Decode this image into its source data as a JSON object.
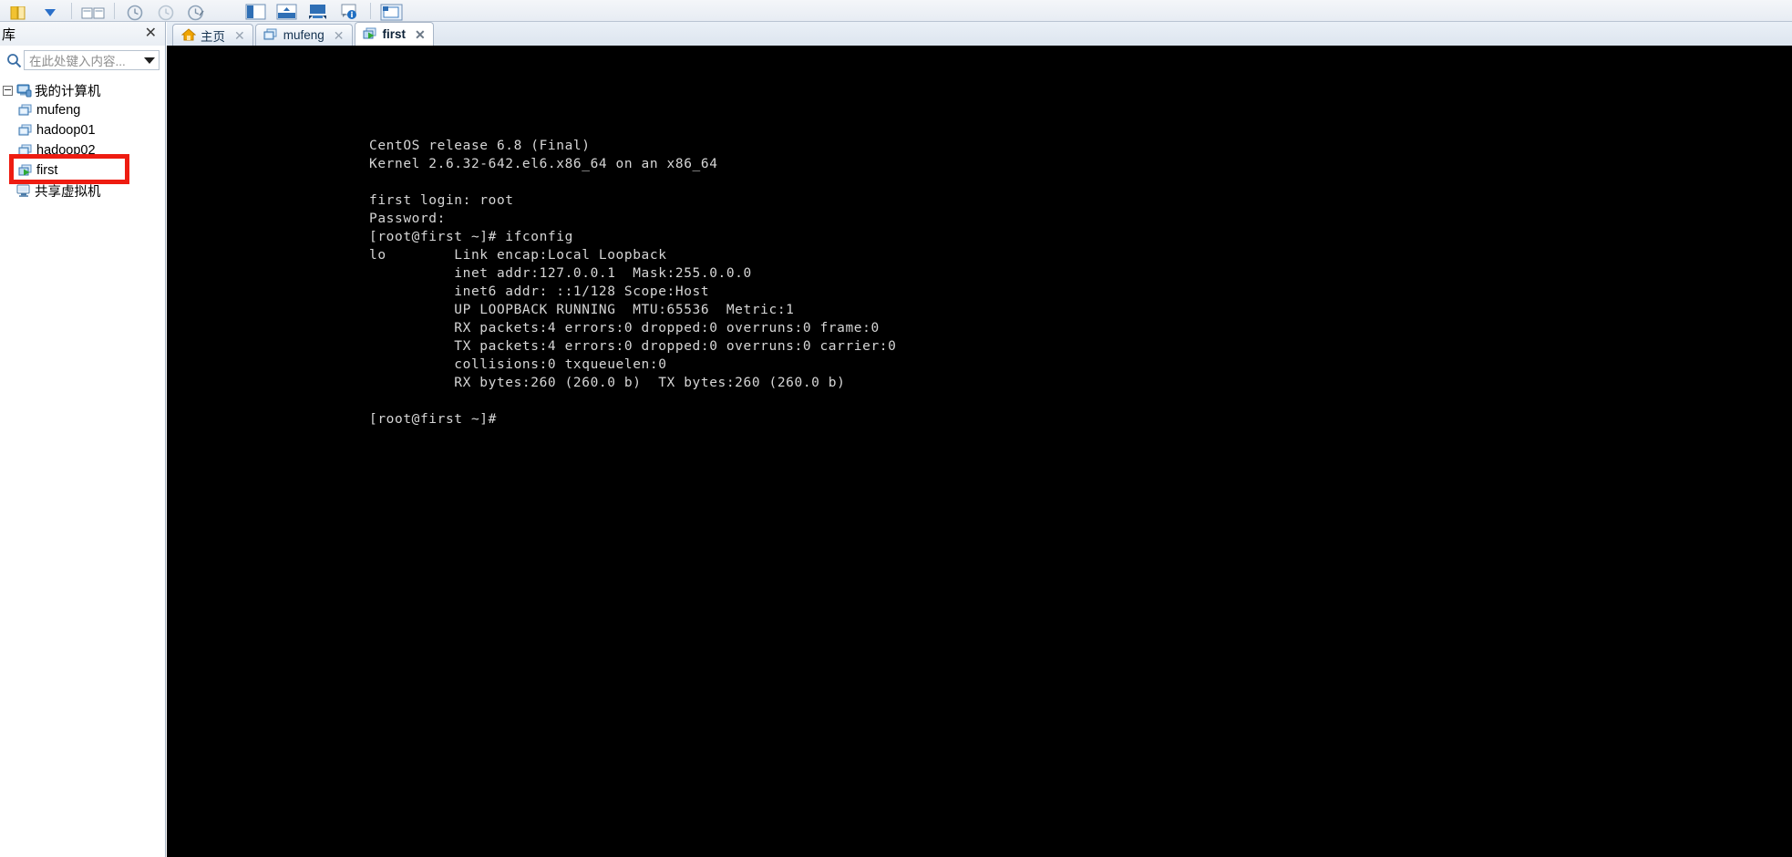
{
  "toolbar": {
    "items": [
      {
        "name": "folder-icon",
        "label": ""
      },
      {
        "name": "dropdown-arrow-icon",
        "label": ""
      },
      {
        "name": "side-by-side-icon",
        "label": ""
      },
      {
        "name": "snapshot-icon",
        "label": ""
      },
      {
        "name": "revert-snapshot-icon",
        "label": ""
      },
      {
        "name": "snapshot-manager-icon",
        "label": ""
      },
      {
        "name": "show-library-icon",
        "label": ""
      },
      {
        "name": "show-thumbnail-bar-icon",
        "label": ""
      },
      {
        "name": "show-console-view-icon",
        "label": ""
      },
      {
        "name": "help-info-icon",
        "label": ""
      },
      {
        "name": "fullscreen-icon",
        "label": ""
      }
    ]
  },
  "library": {
    "title": "库",
    "close_label": "✕",
    "search": {
      "placeholder": "在此处键入内容...",
      "value": ""
    },
    "tree": [
      {
        "label": "我的计算机",
        "icon": "my-computer-icon",
        "level": 0,
        "expanded": true,
        "state": "normal"
      },
      {
        "label": "mufeng",
        "icon": "vm-icon",
        "level": 1,
        "state": "normal"
      },
      {
        "label": "hadoop01",
        "icon": "vm-icon",
        "level": 1,
        "state": "normal"
      },
      {
        "label": "hadoop02",
        "icon": "vm-icon",
        "level": 1,
        "state": "normal"
      },
      {
        "label": "first",
        "icon": "vm-running-icon",
        "level": 1,
        "state": "highlighted"
      },
      {
        "label": "共享虚拟机",
        "icon": "shared-vm-icon",
        "level": 0,
        "state": "normal"
      }
    ],
    "annotation": {
      "color": "#ee1c11",
      "target": "first"
    }
  },
  "tabs": [
    {
      "label": "主页",
      "icon": "home-icon",
      "active": false,
      "close_label": "✕"
    },
    {
      "label": "mufeng",
      "icon": "vm-icon",
      "active": false,
      "close_label": "✕"
    },
    {
      "label": "first",
      "icon": "vm-running-icon",
      "active": true,
      "close_label": "✕"
    }
  ],
  "console": {
    "background_color": "#000000",
    "text_color": "#d6d6d6",
    "lines": [
      "CentOS release 6.8 (Final)",
      "Kernel 2.6.32-642.el6.x86_64 on an x86_64",
      "",
      "first login: root",
      "Password:",
      "[root@first ~]# ifconfig",
      "lo        Link encap:Local Loopback",
      "          inet addr:127.0.0.1  Mask:255.0.0.0",
      "          inet6 addr: ::1/128 Scope:Host",
      "          UP LOOPBACK RUNNING  MTU:65536  Metric:1",
      "          RX packets:4 errors:0 dropped:0 overruns:0 frame:0",
      "          TX packets:4 errors:0 dropped:0 overruns:0 carrier:0",
      "          collisions:0 txqueuelen:0",
      "          RX bytes:260 (260.0 b)  TX bytes:260 (260.0 b)",
      "",
      "[root@first ~]#"
    ]
  }
}
